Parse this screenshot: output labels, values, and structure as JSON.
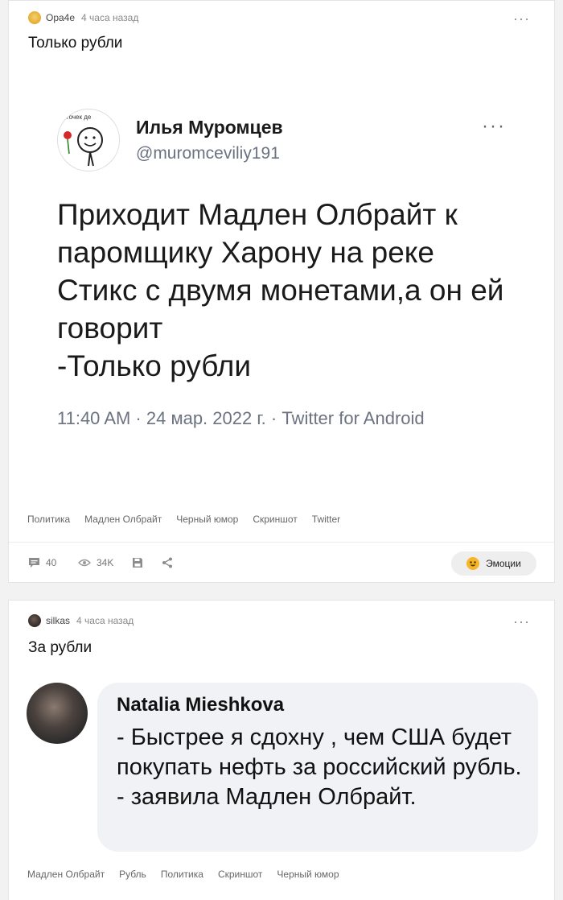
{
  "post1": {
    "author": "Ора4е",
    "time": "4 часа назад",
    "more": "···",
    "title": "Только рубли",
    "tweet": {
      "name": "Илья Муромцев",
      "handle": "@muromceviliy191",
      "more": "···",
      "text": "Приходит Мадлен Олбрайт к паромщику Харону на реке Стикс с двумя монетами,а он ей говорит\n-Только рубли",
      "meta": "11:40 AM · 24 мар. 2022 г. · Twitter for Android",
      "avatar_text": "точек де"
    },
    "tags": [
      "Политика",
      "Мадлен Олбрайт",
      "Черный юмор",
      "Скриншот",
      "Twitter"
    ],
    "stats": {
      "comments": "40",
      "views": "34K"
    },
    "emotions_label": "Эмоции"
  },
  "post2": {
    "author": "silkas",
    "time": "4 часа назад",
    "more": "···",
    "title": "За рубли",
    "fb": {
      "name": "Natalia Mieshkova",
      "text": "- Быстрее я сдохну , чем США будет покупать нефть за российский рубль. - заявила Мадлен Олбрайт."
    },
    "tags": [
      "Мадлен Олбрайт",
      "Рубль",
      "Политика",
      "Скриншот",
      "Черный юмор"
    ]
  },
  "colors": {
    "page_bg": "#f2f2f2",
    "card_bg": "#ffffff",
    "muted": "#8a8a8a",
    "bubble_bg": "#f0f2f5",
    "emoji_yellow": "#f5b629"
  }
}
